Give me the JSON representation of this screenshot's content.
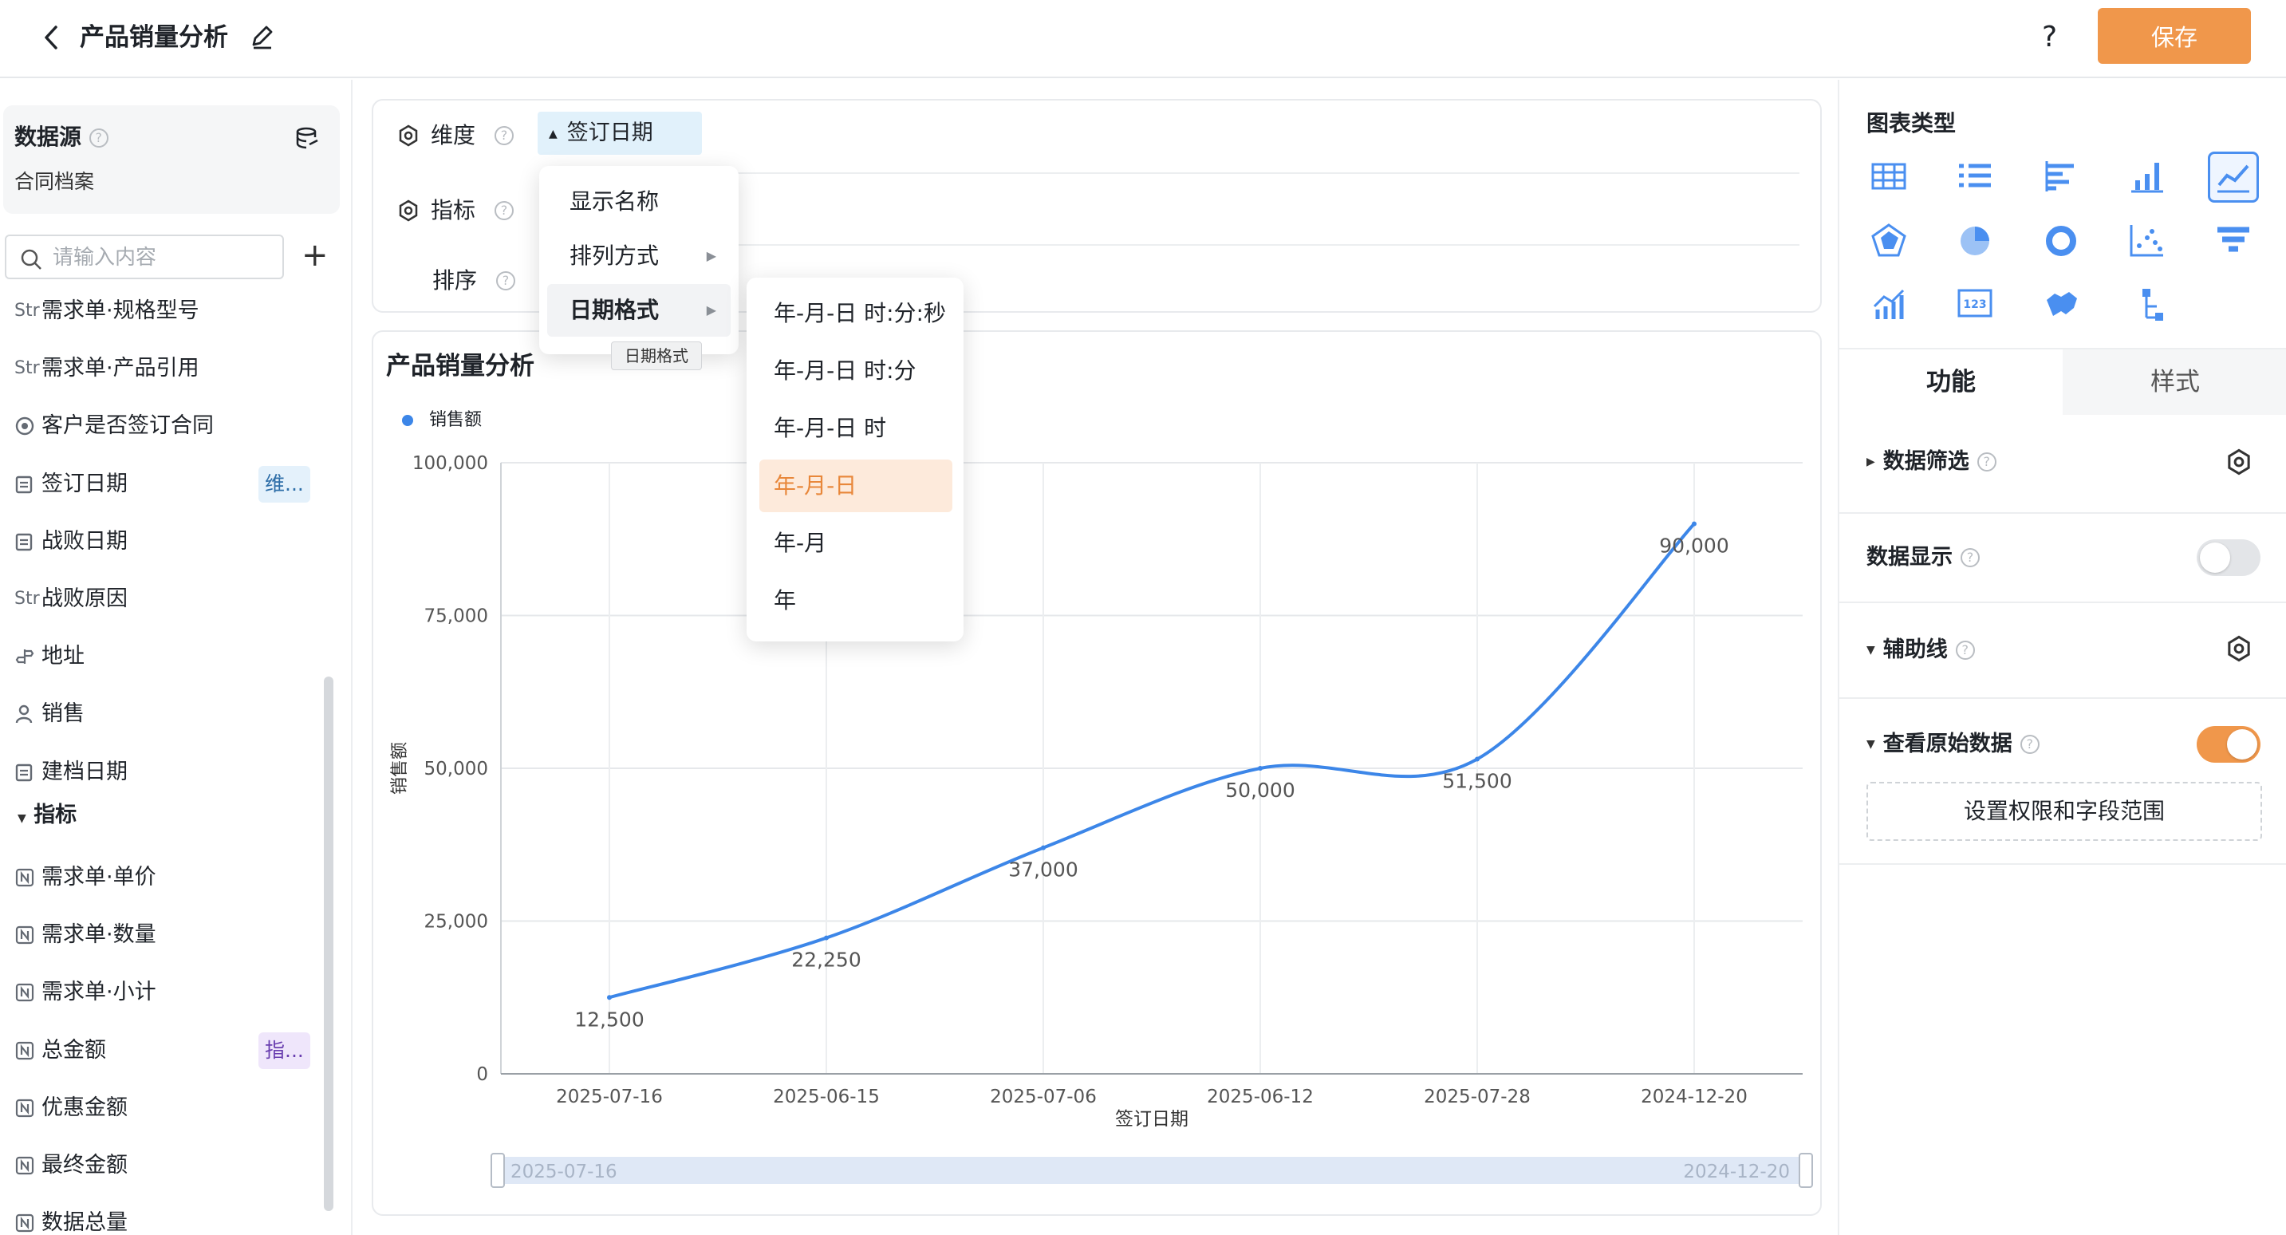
{
  "header": {
    "title": "产品销量分析",
    "save_label": "保存",
    "help_label": "?"
  },
  "datasource": {
    "label": "数据源",
    "name": "合同档案"
  },
  "search": {
    "placeholder": "请输入内容"
  },
  "fields": [
    {
      "icon": "Str",
      "label": "需求单·规格型号"
    },
    {
      "icon": "Str",
      "label": "需求单·产品引用"
    },
    {
      "icon": "radio",
      "label": "客户是否签订合同"
    },
    {
      "icon": "calendar",
      "label": "签订日期",
      "tag": "维..."
    },
    {
      "icon": "calendar",
      "label": "战败日期"
    },
    {
      "icon": "Str",
      "label": "战败原因"
    },
    {
      "icon": "location",
      "label": "地址"
    },
    {
      "icon": "user",
      "label": "销售"
    },
    {
      "icon": "calendar",
      "label": "建档日期"
    }
  ],
  "metrics_header": "指标",
  "metrics": [
    {
      "icon": "N",
      "label": "需求单·单价"
    },
    {
      "icon": "N",
      "label": "需求单·数量"
    },
    {
      "icon": "N",
      "label": "需求单·小计"
    },
    {
      "icon": "N",
      "label": "总金额",
      "tag": "指..."
    },
    {
      "icon": "N",
      "label": "优惠金额"
    },
    {
      "icon": "N",
      "label": "最终金额"
    },
    {
      "icon": "N",
      "label": "数据总量"
    }
  ],
  "config": {
    "dimension_label": "维度",
    "metric_label": "指标",
    "sort_label": "排序",
    "dimension_value": "签订日期"
  },
  "dropdown": {
    "items": [
      "显示名称",
      "排列方式",
      "日期格式"
    ],
    "active": "日期格式",
    "tooltip": "日期格式"
  },
  "date_formats": {
    "items": [
      "年-月-日 时:分:秒",
      "年-月-日 时:分",
      "年-月-日 时",
      "年-月-日",
      "年-月",
      "年"
    ],
    "selected": "年-月-日"
  },
  "chart": {
    "title": "产品销量分析",
    "legend": "销售额",
    "range_start": "2025-07-16",
    "range_end": "2024-12-20"
  },
  "chart_data": {
    "type": "line",
    "categories": [
      "2025-07-16",
      "2025-06-15",
      "2025-07-06",
      "2025-06-12",
      "2025-07-28",
      "2024-12-20"
    ],
    "series": [
      {
        "name": "销售额",
        "values": [
          12500,
          22250,
          37000,
          50000,
          51500,
          90000
        ]
      }
    ],
    "data_labels": [
      "12,500",
      "22,250",
      "37,000",
      "50,000",
      "51,500",
      "90,000"
    ],
    "xlabel": "签订日期",
    "ylabel": "销售额",
    "ylim": [
      0,
      100000
    ],
    "yticks": [
      "0",
      "25,000",
      "50,000",
      "75,000",
      "100,000"
    ],
    "smooth": true,
    "grid": true,
    "color": "#3c86e8"
  },
  "right": {
    "chart_type_label": "图表类型",
    "chart_types": [
      "table-icon",
      "list-icon",
      "bar-horizontal-icon",
      "bar-chart-icon",
      "line-chart-icon",
      "radar-icon",
      "pie-icon",
      "donut-icon",
      "scatter-icon",
      "funnel-icon",
      "combo-chart-icon",
      "number-card-icon",
      "map-icon",
      "tree-icon"
    ],
    "tab_function": "功能",
    "tab_style": "样式",
    "filter_label": "数据筛选",
    "display_label": "数据显示",
    "auxline_label": "辅助线",
    "raw_label": "查看原始数据",
    "perm_label": "设置权限和字段范围"
  },
  "colors": {
    "accent": "#f0974b",
    "line": "#3c86e8"
  }
}
